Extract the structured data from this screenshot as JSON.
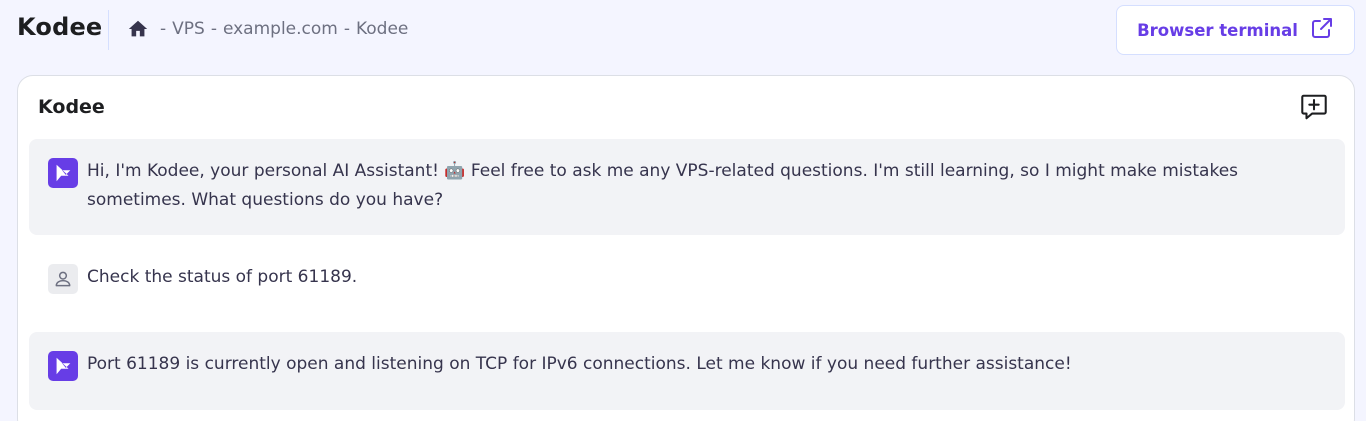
{
  "app": {
    "title": "Kodee"
  },
  "breadcrumb": {
    "home_icon": "home-icon",
    "separator": "-",
    "items": [
      "VPS",
      "example.com",
      "Kodee"
    ]
  },
  "header_button": {
    "label": "Browser terminal",
    "icon": "external-link-icon"
  },
  "chat": {
    "title": "Kodee",
    "new_chat_icon": "new-chat-icon",
    "messages": [
      {
        "role": "assistant",
        "avatar": "kodee-logo-icon",
        "text": "Hi, I'm Kodee, your personal AI Assistant! 🤖 Feel free to ask me any VPS-related questions. I'm still learning, so I might make mistakes sometimes. What questions do you have?"
      },
      {
        "role": "user",
        "avatar": "user-icon",
        "text": "Check the status of port 61189."
      },
      {
        "role": "assistant",
        "avatar": "kodee-logo-icon",
        "text": "Port 61189 is currently open and listening on TCP for IPv6 connections. Let me know if you need further assistance!"
      }
    ]
  },
  "colors": {
    "accent": "#673de6",
    "background": "#f4f5ff",
    "assistant_bubble": "#f2f3f6",
    "text": "#36344d"
  }
}
